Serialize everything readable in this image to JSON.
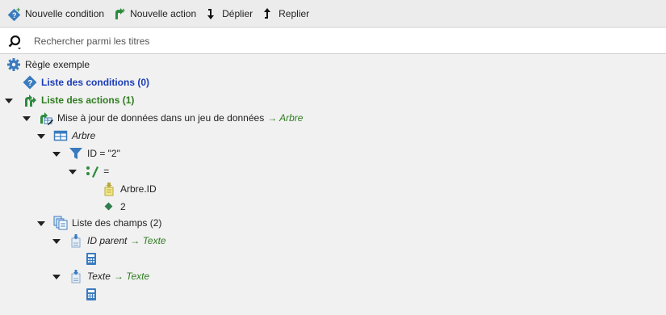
{
  "toolbar": {
    "new_condition": "Nouvelle condition",
    "new_action": "Nouvelle action",
    "expand": "Déplier",
    "collapse": "Replier"
  },
  "search": {
    "placeholder": "Rechercher parmi les titres",
    "value": ""
  },
  "tree": {
    "rule": "Règle exemple",
    "conditions": "Liste des conditions (0)",
    "actions": "Liste des actions (1)",
    "action_update": "Mise à jour de données dans un jeu de données",
    "action_update_target": "→ Arbre",
    "table": "Arbre",
    "filter": "ID = \"2\"",
    "operator": "=",
    "operand_field": "Arbre.ID",
    "operand_value": "2",
    "fields_list": "Liste des champs (2)",
    "field1_name": "ID parent",
    "field1_target": "→ Texte",
    "field2_name": "Texte",
    "field2_target": "→ Texte"
  },
  "colors": {
    "blue_link": "#1a3bb8",
    "green_link": "#2e7d1e",
    "accent": "#6b6bd6"
  }
}
